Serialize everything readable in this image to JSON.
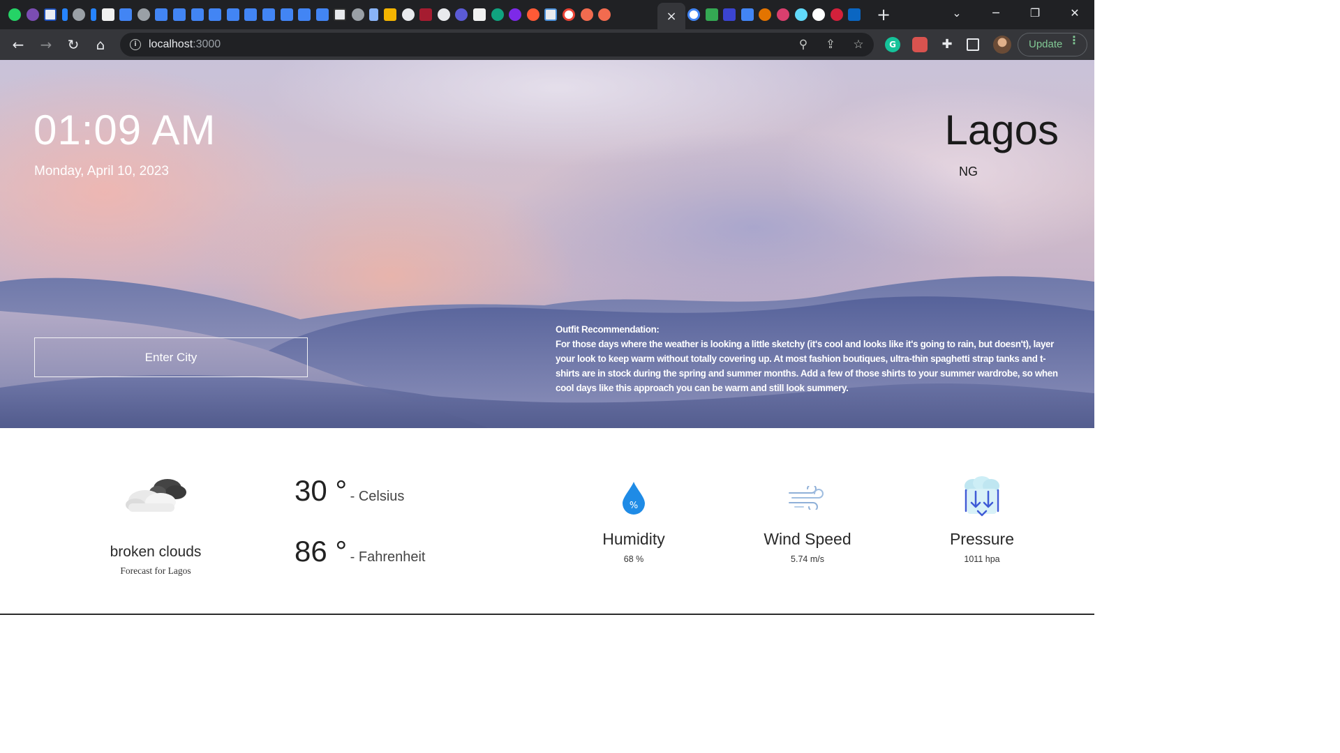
{
  "browser": {
    "url_host": "localhost",
    "url_port": ":3000",
    "active_tab_close": "×",
    "new_tab": "+",
    "update_label": "Update",
    "icons": {
      "tab_favicons": [
        "whatsapp",
        "app",
        "app",
        "jira",
        "globe",
        "jira",
        "news",
        "docs",
        "globe",
        "docs",
        "docs",
        "docs",
        "docs",
        "docs",
        "docs",
        "docs",
        "docs",
        "docs",
        "docs",
        "app",
        "globe",
        "file",
        "app",
        "app",
        "harvard",
        "app",
        "app",
        "app",
        "openai",
        "app",
        "app",
        "app",
        "google",
        "app",
        "app"
      ],
      "tab_favicons_2": [
        "google",
        "app",
        "app",
        "docs",
        "app",
        "app",
        "react",
        "github",
        "app",
        "linkedin"
      ]
    },
    "colors": {
      "tabstrip": "#202124",
      "toolbar": "#35363a",
      "update": "#81c995"
    }
  },
  "weather": {
    "time": "01:09 AM",
    "date": "Monday, April 10, 2023",
    "city": "Lagos",
    "country": "NG",
    "input_placeholder": "Enter City",
    "outfit_title": "Outfit Recommendation:",
    "outfit_text": "For those days where the weather is looking a little sketchy (it's cool and looks like it's going to rain, but doesn't), layer your look to keep warm without totally covering up. At most fashion boutiques, ultra-thin spaghetti strap tanks and t-shirts are in stock during the spring and summer months. Add a few of those shirts to your summer wardrobe, so when cool days like this approach you can be warm and still look summery.",
    "condition": "broken clouds",
    "forecast_for": "Forecast for Lagos",
    "temp_c": "30 °",
    "temp_c_unit": "- Celsius",
    "temp_f": "86 °",
    "temp_f_unit": "- Fahrenheit",
    "humidity_label": "Humidity",
    "humidity_value": "68 %",
    "humidity_icon_text": "%",
    "wind_label": "Wind Speed",
    "wind_value": "5.74 m/s",
    "pressure_label": "Pressure",
    "pressure_value": "1011 hpa",
    "icons": {
      "condition": "broken-clouds-icon",
      "humidity": "water-drop-icon",
      "wind": "wind-icon",
      "pressure": "pressure-icon"
    },
    "colors": {
      "humidity_icon": "#1f8be6",
      "pressure_icon": "#3f5bd6"
    }
  }
}
